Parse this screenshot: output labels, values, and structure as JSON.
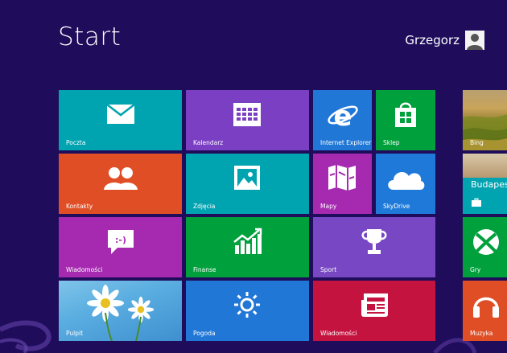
{
  "header": {
    "title": "Start",
    "user_name": "Grzegorz"
  },
  "tiles": {
    "poczta": "Poczta",
    "kalendarz": "Kalendarz",
    "internet_explorer": "Internet Explorer",
    "sklep": "Sklep",
    "bing": "Bing",
    "kontakty": "Kontakty",
    "zdjecia": "Zdjęcia",
    "mapy": "Mapy",
    "skydrive": "SkyDrive",
    "travel_city": "Budapes",
    "wiadomosci_messaging": "Wiadomości",
    "finanse": "Finanse",
    "sport": "Sport",
    "gry": "Gry",
    "pulpit": "Pulpit",
    "pogoda": "Pogoda",
    "wiadomosci_news": "Wiadomości",
    "muzyka": "Muzyka"
  },
  "colors": {
    "background": "#1f0d5c",
    "teal": "#00a3b0",
    "purple": "#7b3fc4",
    "blue": "#2177d6",
    "green": "#00a03c",
    "orange": "#e04e25",
    "magenta": "#a52ab0",
    "sky": "#1e79d8",
    "violet": "#7848c4",
    "crimson": "#c4133f",
    "red": "#c8213b"
  }
}
